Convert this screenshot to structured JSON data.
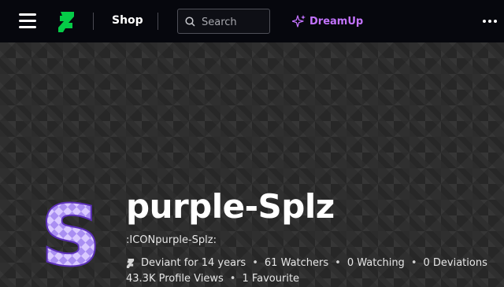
{
  "header": {
    "shop_label": "Shop",
    "search_placeholder": "Search",
    "dreamup_label": "DreamUp",
    "brand_color": "#05cc47",
    "dreamup_color": "#c373ff"
  },
  "profile": {
    "username": "purple-Splz",
    "tagline": ":ICONpurple-Splz:",
    "deviant_for": "Deviant for 14 years",
    "watchers": "61 Watchers",
    "watching": "0 Watching",
    "deviations": "0 Deviations",
    "profile_views": "43.3K Profile Views",
    "favourites": "1 Favourite",
    "avatar_letter": "S"
  }
}
